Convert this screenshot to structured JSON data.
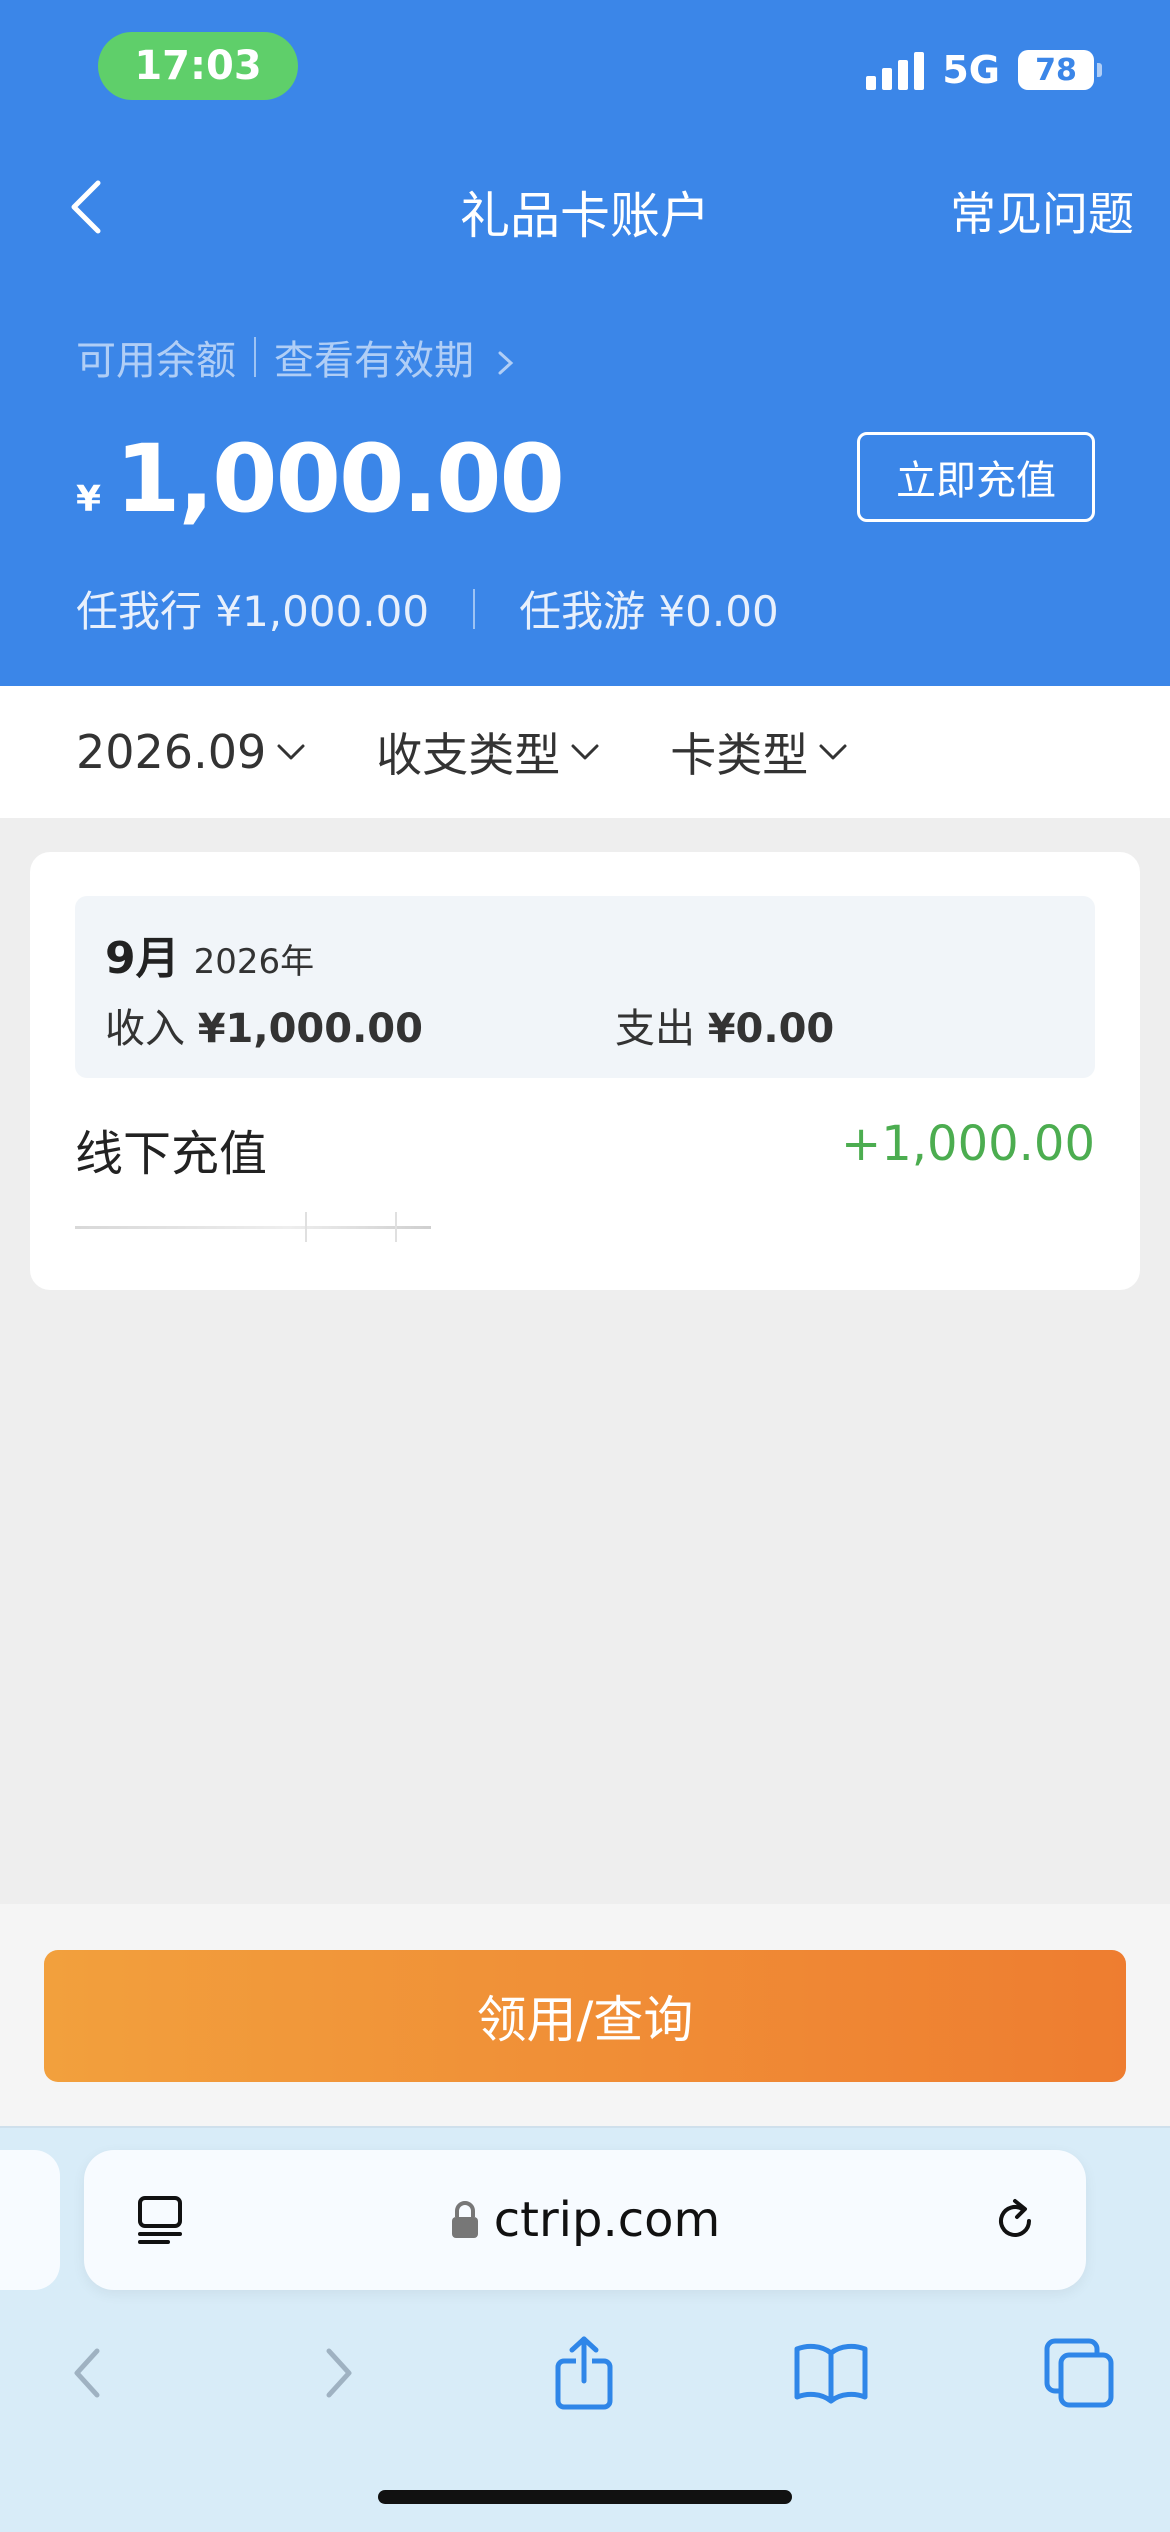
{
  "status": {
    "time": "17:03",
    "network": "5G",
    "battery": "78"
  },
  "nav": {
    "title": "礼品卡账户",
    "faq": "常见问题"
  },
  "balance": {
    "label": "可用余额",
    "validity_link": "查看有效期",
    "currency": "¥",
    "amount": "1,000.00",
    "topup_button": "立即充值",
    "renwoxing": "任我行 ¥1,000.00",
    "renwoyou": "任我游 ¥0.00"
  },
  "filters": [
    {
      "label": "2026.09"
    },
    {
      "label": "收支类型"
    },
    {
      "label": "卡类型"
    }
  ],
  "summary": {
    "month": "9月",
    "year": "2026年",
    "income_label": "收入",
    "income_value": "¥1,000.00",
    "expense_label": "支出",
    "expense_value": "¥0.00"
  },
  "transactions": [
    {
      "title": "线下充值",
      "amount": "+1,000.00"
    }
  ],
  "action": {
    "button": "领用/查询"
  },
  "browser": {
    "url": "ctrip.com"
  },
  "colors": {
    "header_blue": "#3b86e8",
    "income_green": "#4cad50",
    "button_orange": "#ef8a35"
  }
}
